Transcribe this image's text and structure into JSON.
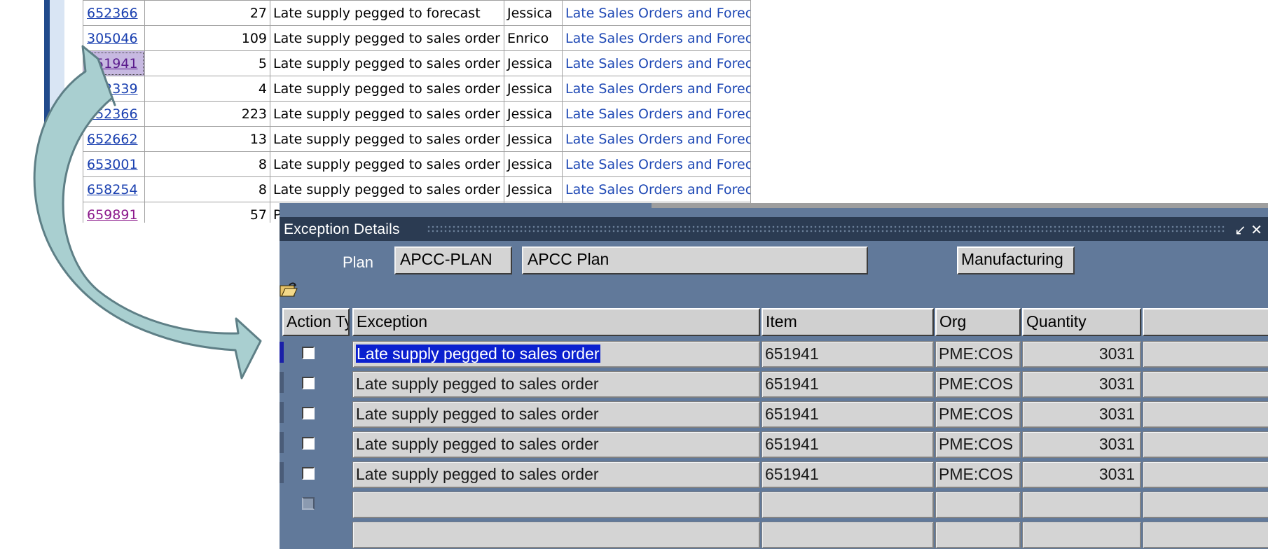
{
  "report": {
    "rows": [
      {
        "item": "652366",
        "qty": "27",
        "exception": "Late supply pegged to forecast",
        "planner": "Jessica",
        "link": "Late Sales Orders and Forecasts"
      },
      {
        "item": "305046",
        "qty": "109",
        "exception": "Late supply pegged to sales order",
        "planner": "Enrico",
        "link": "Late Sales Orders and Forecasts"
      },
      {
        "item": "651941",
        "qty": "5",
        "exception": "Late supply pegged to sales order",
        "planner": "Jessica",
        "link": "Late Sales Orders and Forecasts"
      },
      {
        "item": "652339",
        "qty": "4",
        "exception": "Late supply pegged to sales order",
        "planner": "Jessica",
        "link": "Late Sales Orders and Forecasts"
      },
      {
        "item": "652366",
        "qty": "223",
        "exception": "Late supply pegged to sales order",
        "planner": "Jessica",
        "link": "Late Sales Orders and Forecasts"
      },
      {
        "item": "652662",
        "qty": "13",
        "exception": "Late supply pegged to sales order",
        "planner": "Jessica",
        "link": "Late Sales Orders and Forecasts"
      },
      {
        "item": "653001",
        "qty": "8",
        "exception": "Late supply pegged to sales order",
        "planner": "Jessica",
        "link": "Late Sales Orders and Forecasts"
      },
      {
        "item": "658254",
        "qty": "8",
        "exception": "Late supply pegged to sales order",
        "planner": "Jessica",
        "link": "Late Sales Orders and Forecasts"
      },
      {
        "item": "659891",
        "qty": "57",
        "exception": "P",
        "planner": "",
        "link": ""
      }
    ]
  },
  "window": {
    "title": "Exception Details",
    "controls": "↙ ✕",
    "plan_label": "Plan",
    "plan_code": "APCC-PLAN",
    "plan_name": "APCC Plan",
    "org_type_button": "Manufacturing",
    "columns": {
      "action": "Action Type",
      "exception": "Exception",
      "item": "Item",
      "org": "Org",
      "quantity": "Quantity"
    },
    "rows": [
      {
        "exception": "Late supply pegged to sales order",
        "item": "651941",
        "org": "PME:COS",
        "quantity": "3031"
      },
      {
        "exception": "Late supply pegged to sales order",
        "item": "651941",
        "org": "PME:COS",
        "quantity": "3031"
      },
      {
        "exception": "Late supply pegged to sales order",
        "item": "651941",
        "org": "PME:COS",
        "quantity": "3031"
      },
      {
        "exception": "Late supply pegged to sales order",
        "item": "651941",
        "org": "PME:COS",
        "quantity": "3031"
      },
      {
        "exception": "Late supply pegged to sales order",
        "item": "651941",
        "org": "PME:COS",
        "quantity": "3031"
      },
      {
        "exception": "",
        "item": "",
        "org": "",
        "quantity": ""
      }
    ]
  },
  "colors": {
    "window_bg": "#61799a",
    "titlebar": "#2b3b52",
    "highlight": "#0a1fcf",
    "link": "#1f49b5",
    "arrow_fill": "#a9cfd0",
    "arrow_stroke": "#5e7f86"
  }
}
